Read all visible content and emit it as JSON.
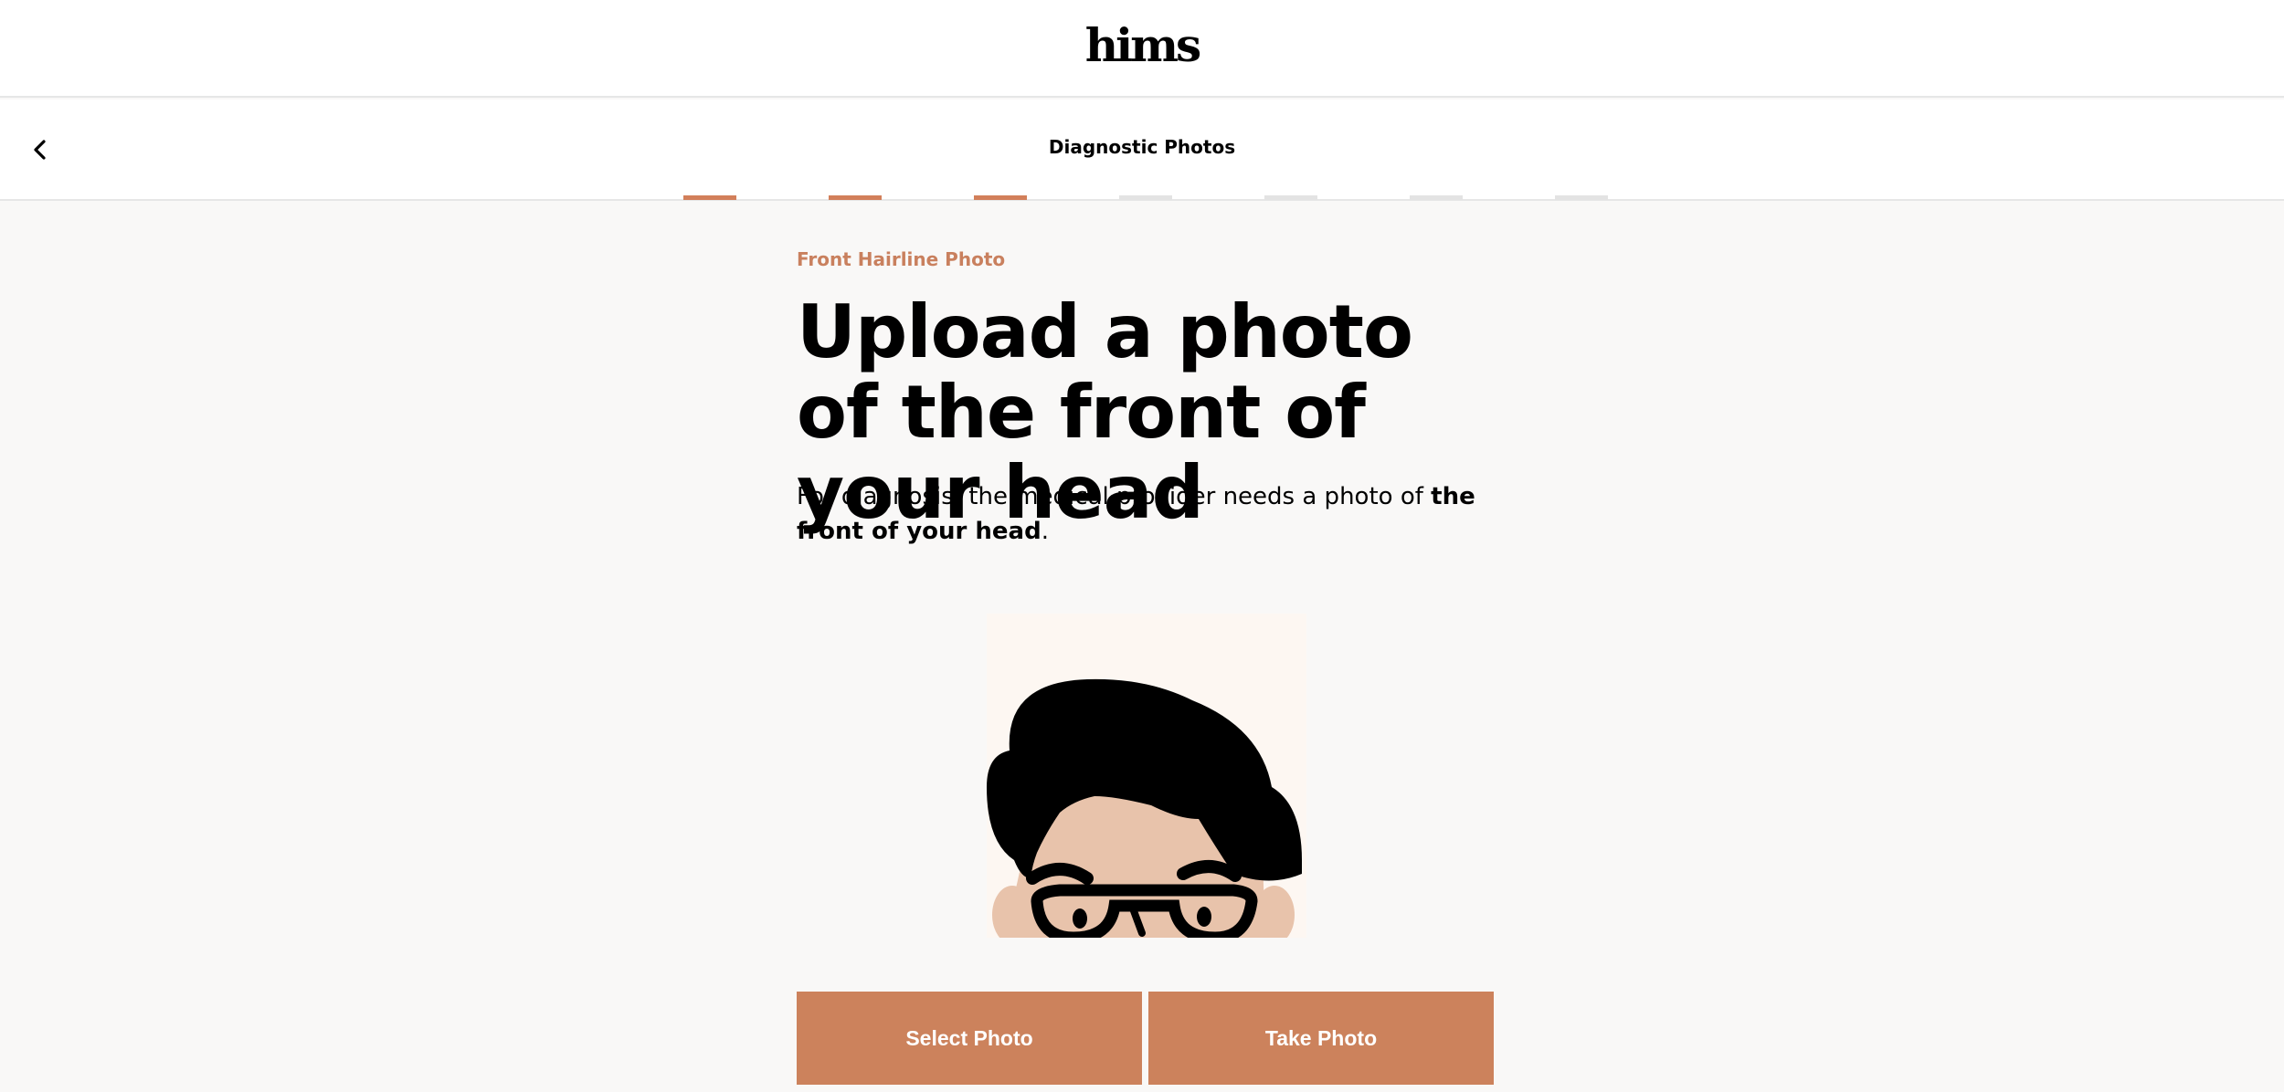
{
  "brand": {
    "logo_text": "hims",
    "accent_color": "#cc825c"
  },
  "nav": {
    "title": "Diagnostic Photos",
    "back_icon": "chevron-left-icon"
  },
  "progress": {
    "total_steps": 7,
    "completed_steps": 3
  },
  "step": {
    "eyebrow": "Front Hairline Photo",
    "headline": "Upload a photo of the front of your head",
    "description_prefix": "For diagnosis, the medical provider needs a photo of ",
    "description_bold": "the front of your head",
    "description_suffix": "."
  },
  "illustration": {
    "icon": "head-with-glasses-illustration"
  },
  "actions": {
    "select_label": "Select Photo",
    "take_label": "Take Photo"
  }
}
